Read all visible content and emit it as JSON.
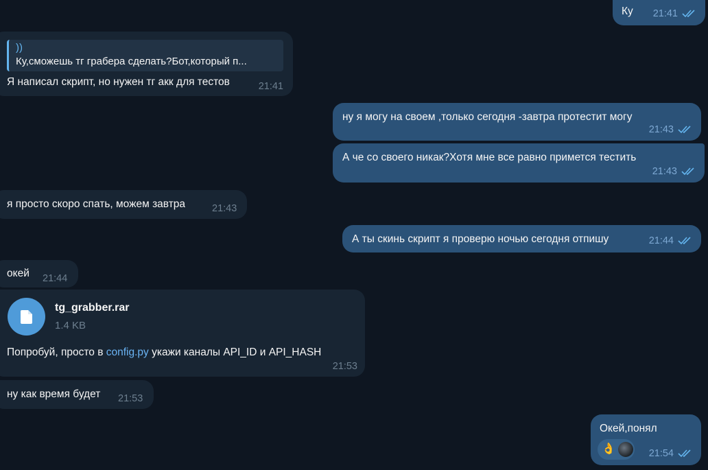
{
  "colors": {
    "background": "#0e1621",
    "incoming": "#182533",
    "outgoing": "#2b5278",
    "link": "#6ab3f3",
    "checks": "#64b5ef"
  },
  "messages": [
    {
      "text": "Ку",
      "time": "21:41",
      "direction": "out",
      "read": true
    },
    {
      "reply_to": {
        "author": "))",
        "text": "Ку,сможешь тг грабера сделать?Бот,который п..."
      },
      "text": "Я написал скрипт, но нужен тг акк для тестов",
      "time": "21:41",
      "direction": "in"
    },
    {
      "text": "ну я могу на своем  ,только сегодня -завтра протестит могу",
      "time": "21:43",
      "direction": "out",
      "read": true
    },
    {
      "text": "А че со своего никак?Хотя мне все равно примется тестить",
      "time": "21:43",
      "direction": "out",
      "read": true
    },
    {
      "text": "я просто скоро спать, можем завтра",
      "time": "21:43",
      "direction": "in"
    },
    {
      "text": "А ты скинь скрипт я проверю ночью сегодня отпишу",
      "time": "21:44",
      "direction": "out",
      "read": true
    },
    {
      "text": "окей",
      "time": "21:44",
      "direction": "in"
    },
    {
      "file": {
        "name": "tg_grabber.rar",
        "size": "1.4 KB",
        "icon": "document-icon"
      },
      "caption_before": "Попробуй, просто в ",
      "caption_link": "config.py",
      "caption_after": " укажи каналы API_ID и API_HASH",
      "time": "21:53",
      "direction": "in"
    },
    {
      "text": "ну как время будет",
      "time": "21:53",
      "direction": "in"
    },
    {
      "text": "Окей,понял",
      "time": "21:54",
      "direction": "out",
      "read": true,
      "reaction": {
        "emoji": "👌",
        "icon": "ok-hand-emoji"
      }
    }
  ]
}
